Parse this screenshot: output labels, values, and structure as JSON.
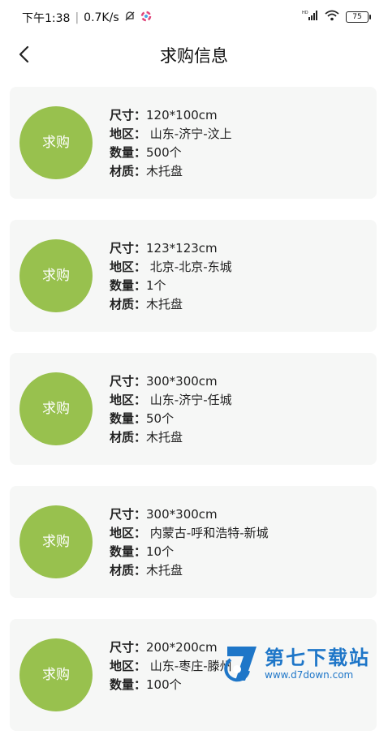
{
  "status_bar": {
    "time": "下午1:38",
    "net_speed": "0.7K/s",
    "signal_label": "HD",
    "battery": "75"
  },
  "nav": {
    "title": "求购信息"
  },
  "labels": {
    "size": "尺寸：",
    "region": "地区：",
    "quantity": "数量：",
    "material": "材质："
  },
  "badge_label": "求购",
  "items": [
    {
      "size": "120*100cm",
      "region": "山东-济宁-汶上",
      "quantity": "500个",
      "material": "木托盘"
    },
    {
      "size": "123*123cm",
      "region": "北京-北京-东城",
      "quantity": "1个",
      "material": "木托盘"
    },
    {
      "size": "300*300cm",
      "region": "山东-济宁-任城",
      "quantity": "50个",
      "material": "木托盘"
    },
    {
      "size": "300*300cm",
      "region": "内蒙古-呼和浩特-新城",
      "quantity": "10个",
      "material": "木托盘"
    },
    {
      "size": "200*200cm",
      "region": "山东-枣庄-滕州",
      "quantity": "100个",
      "material": ""
    }
  ],
  "watermark": {
    "name": "第七下载站",
    "url": "www.d7down.com"
  }
}
